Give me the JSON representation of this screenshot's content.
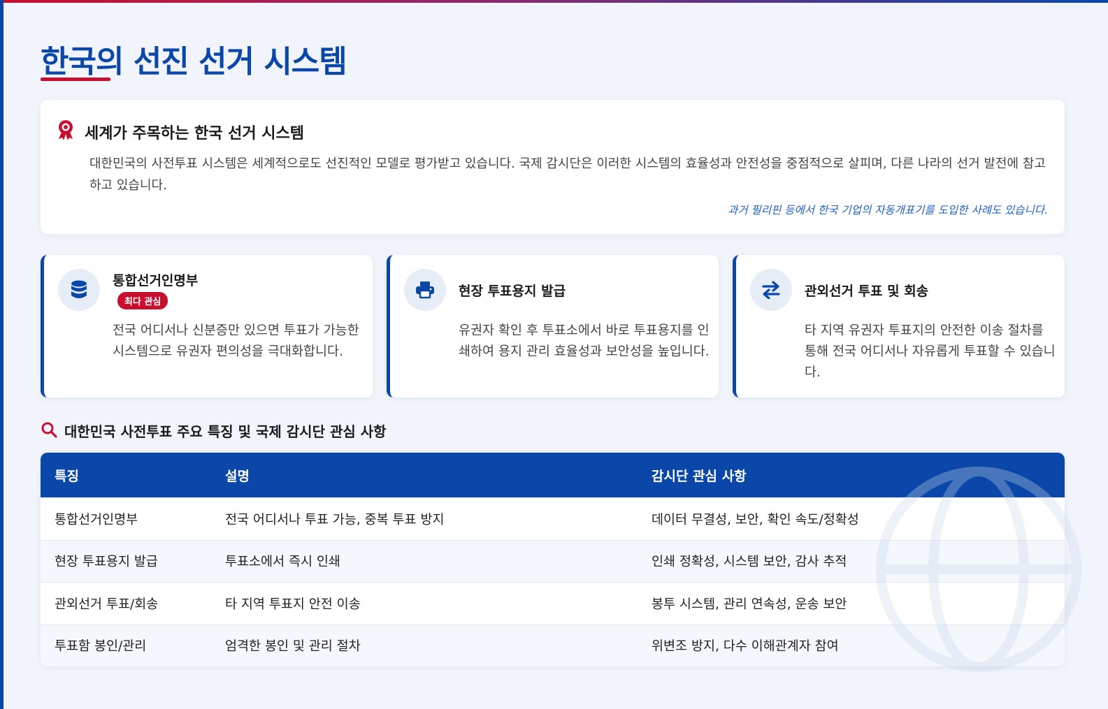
{
  "page": {
    "title": "한국의 선진 선거 시스템"
  },
  "intro": {
    "icon": "award-ribbon-icon",
    "title": "세계가 주목하는 한국 선거 시스템",
    "body": "대한민국의 사전투표 시스템은 세계적으로도 선진적인 모델로 평가받고 있습니다. 국제 감시단은 이러한 시스템의 효율성과 안전성을 중점적으로 살피며, 다른 나라의 선거 발전에 참고하고 있습니다.",
    "note": "과거 필리핀 등에서 한국 기업의 자동개표기를 도입한 사례도 있습니다."
  },
  "features": [
    {
      "icon": "database-icon",
      "title": "통합선거인명부",
      "badge": "최다 관심",
      "body": "전국 어디서나 신분증만 있으면 투표가 가능한 시스템으로 유권자 편의성을 극대화합니다."
    },
    {
      "icon": "printer-icon",
      "title": "현장 투표용지 발급",
      "body": "유권자 확인 후 투표소에서 바로 투표용지를 인쇄하여 용지 관리 효율성과 보안성을 높입니다."
    },
    {
      "icon": "exchange-arrows-icon",
      "title": "관외선거 투표 및 회송",
      "body": "타 지역 유권자 투표지의 안전한 이송 절차를 통해 전국 어디서나 자유롭게 투표할 수 있습니다."
    }
  ],
  "section": {
    "icon": "search-icon",
    "title": "대한민국 사전투표 주요 특징 및 국제 감시단 관심 사항"
  },
  "table": {
    "headers": [
      "특징",
      "설명",
      "감시단 관심 사항"
    ],
    "rows": [
      [
        "통합선거인명부",
        "전국 어디서나 투표 가능, 중복 투표 방지",
        "데이터 무결성, 보안, 확인 속도/정확성"
      ],
      [
        "현장 투표용지 발급",
        "투표소에서 즉시 인쇄",
        "인쇄 정확성, 시스템 보안, 감사 추적"
      ],
      [
        "관외선거 투표/회송",
        "타 지역 투표지 안전 이송",
        "봉투 시스템, 관리 연속성, 운송 보안"
      ],
      [
        "투표함 봉인/관리",
        "엄격한 봉인 및 관리 절차",
        "위변조 방지, 다수 이해관계자 참여"
      ]
    ]
  },
  "colors": {
    "primary": "#0a47a8",
    "accent": "#c8102e",
    "background": "#f1f5fb",
    "note": "#1f5fc9"
  }
}
